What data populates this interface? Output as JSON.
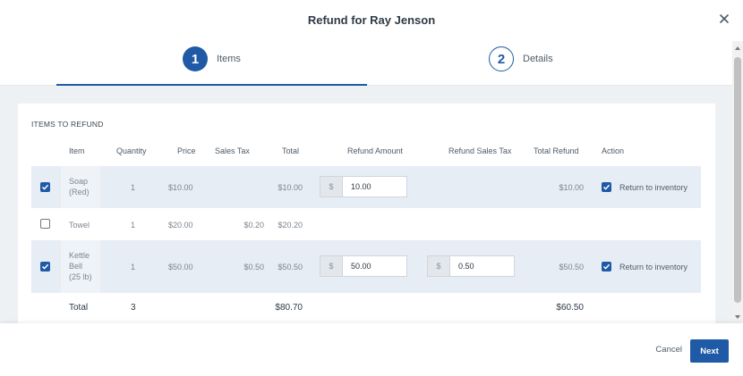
{
  "dialog": {
    "title": "Refund for Ray Jenson"
  },
  "steps": [
    {
      "number": "1",
      "label": "Items"
    },
    {
      "number": "2",
      "label": "Details"
    }
  ],
  "section_title": "ITEMS TO REFUND",
  "columns": {
    "item": "Item",
    "quantity": "Quantity",
    "price": "Price",
    "sales_tax": "Sales Tax",
    "total": "Total",
    "refund_amount": "Refund Amount",
    "refund_sales_tax": "Refund Sales Tax",
    "total_refund": "Total Refund",
    "action": "Action"
  },
  "rows": [
    {
      "checked": true,
      "item_line1": "Soap",
      "item_line2": "(Red)",
      "quantity": "1",
      "price": "$10.00",
      "sales_tax": "",
      "total": "$10.00",
      "refund_prefix": "$",
      "refund_amount": "10.00",
      "total_refund": "$10.00",
      "action_checked": true,
      "action_label": "Return to inventory"
    },
    {
      "checked": false,
      "item_line1": "Towel",
      "quantity": "1",
      "price": "$20.00",
      "sales_tax": "$0.20",
      "total": "$20.20"
    },
    {
      "checked": true,
      "item_line1": "Kettle",
      "item_line2": "Bell",
      "item_line3": "(25 lb)",
      "quantity": "1",
      "price": "$50.00",
      "sales_tax": "$0.50",
      "total": "$50.50",
      "refund_prefix": "$",
      "refund_amount": "50.00",
      "refund_tax_prefix": "$",
      "refund_sales_tax": "0.50",
      "total_refund": "$50.50",
      "action_checked": true,
      "action_label": "Return to inventory"
    }
  ],
  "totals": {
    "label": "Total",
    "quantity": "3",
    "total": "$80.70",
    "total_refund": "$60.50"
  },
  "footer": {
    "cancel_label": "Cancel",
    "next_label": "Next"
  },
  "colors": {
    "accent": "#1f5aa6",
    "selected_row": "#e7edf5",
    "content_bg": "#eef1f4"
  }
}
